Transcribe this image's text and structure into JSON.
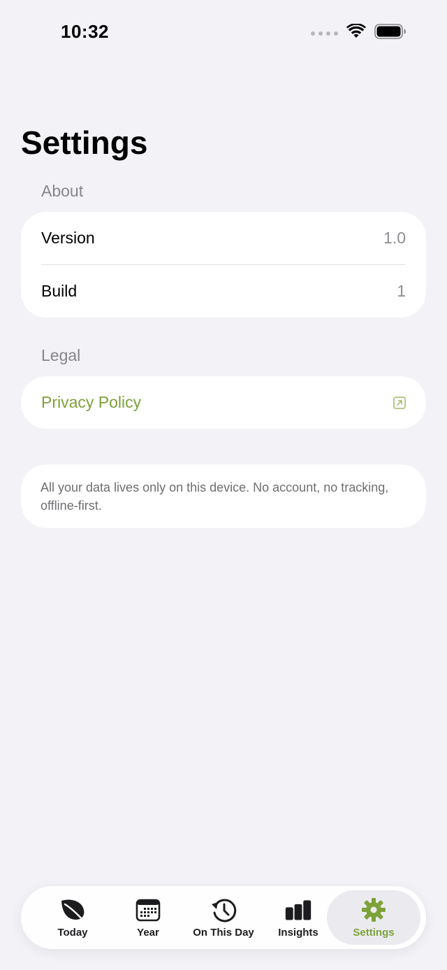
{
  "status_bar": {
    "time": "10:32"
  },
  "page_title": "Settings",
  "about": {
    "header": "About",
    "rows": [
      {
        "label": "Version",
        "value": "1.0"
      },
      {
        "label": "Build",
        "value": "1"
      }
    ]
  },
  "legal": {
    "header": "Legal",
    "privacy_label": "Privacy Policy",
    "privacy_icon": "external-link-icon"
  },
  "note": "All your data lives only on this device. No account, no tracking, offline-first.",
  "tabs": [
    {
      "label": "Today",
      "icon": "leaf-icon"
    },
    {
      "label": "Year",
      "icon": "calendar-icon"
    },
    {
      "label": "On This Day",
      "icon": "history-clock-icon"
    },
    {
      "label": "Insights",
      "icon": "bar-chart-icon"
    },
    {
      "label": "Settings",
      "icon": "gear-icon",
      "active": true
    }
  ],
  "colors": {
    "accent": "#7DA23A",
    "background": "#F2F2F7",
    "card": "#FFFFFF",
    "secondary_text": "#86868B"
  }
}
